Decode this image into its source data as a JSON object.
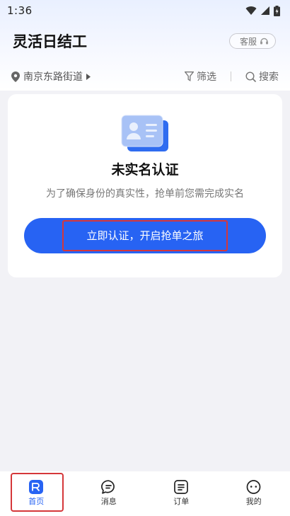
{
  "status_bar": {
    "time": "1:36"
  },
  "header": {
    "title": "灵活日结工",
    "service_label": "客服"
  },
  "filter_row": {
    "location": "南京东路街道",
    "filter_label": "筛选",
    "search_label": "搜索"
  },
  "verify_card": {
    "title": "未实名认证",
    "description": "为了确保身份的真实性，抢单前您需完成实名",
    "button_label": "立即认证，开启抢单之旅"
  },
  "tabbar": {
    "items": [
      {
        "label": "首页",
        "icon": "home-icon",
        "active": true
      },
      {
        "label": "消息",
        "icon": "message-icon",
        "active": false
      },
      {
        "label": "订单",
        "icon": "order-icon",
        "active": false
      },
      {
        "label": "我的",
        "icon": "profile-icon",
        "active": false
      }
    ]
  },
  "colors": {
    "accent": "#2763f3",
    "highlight_border": "#d5373a",
    "background": "#f2f2f6"
  }
}
